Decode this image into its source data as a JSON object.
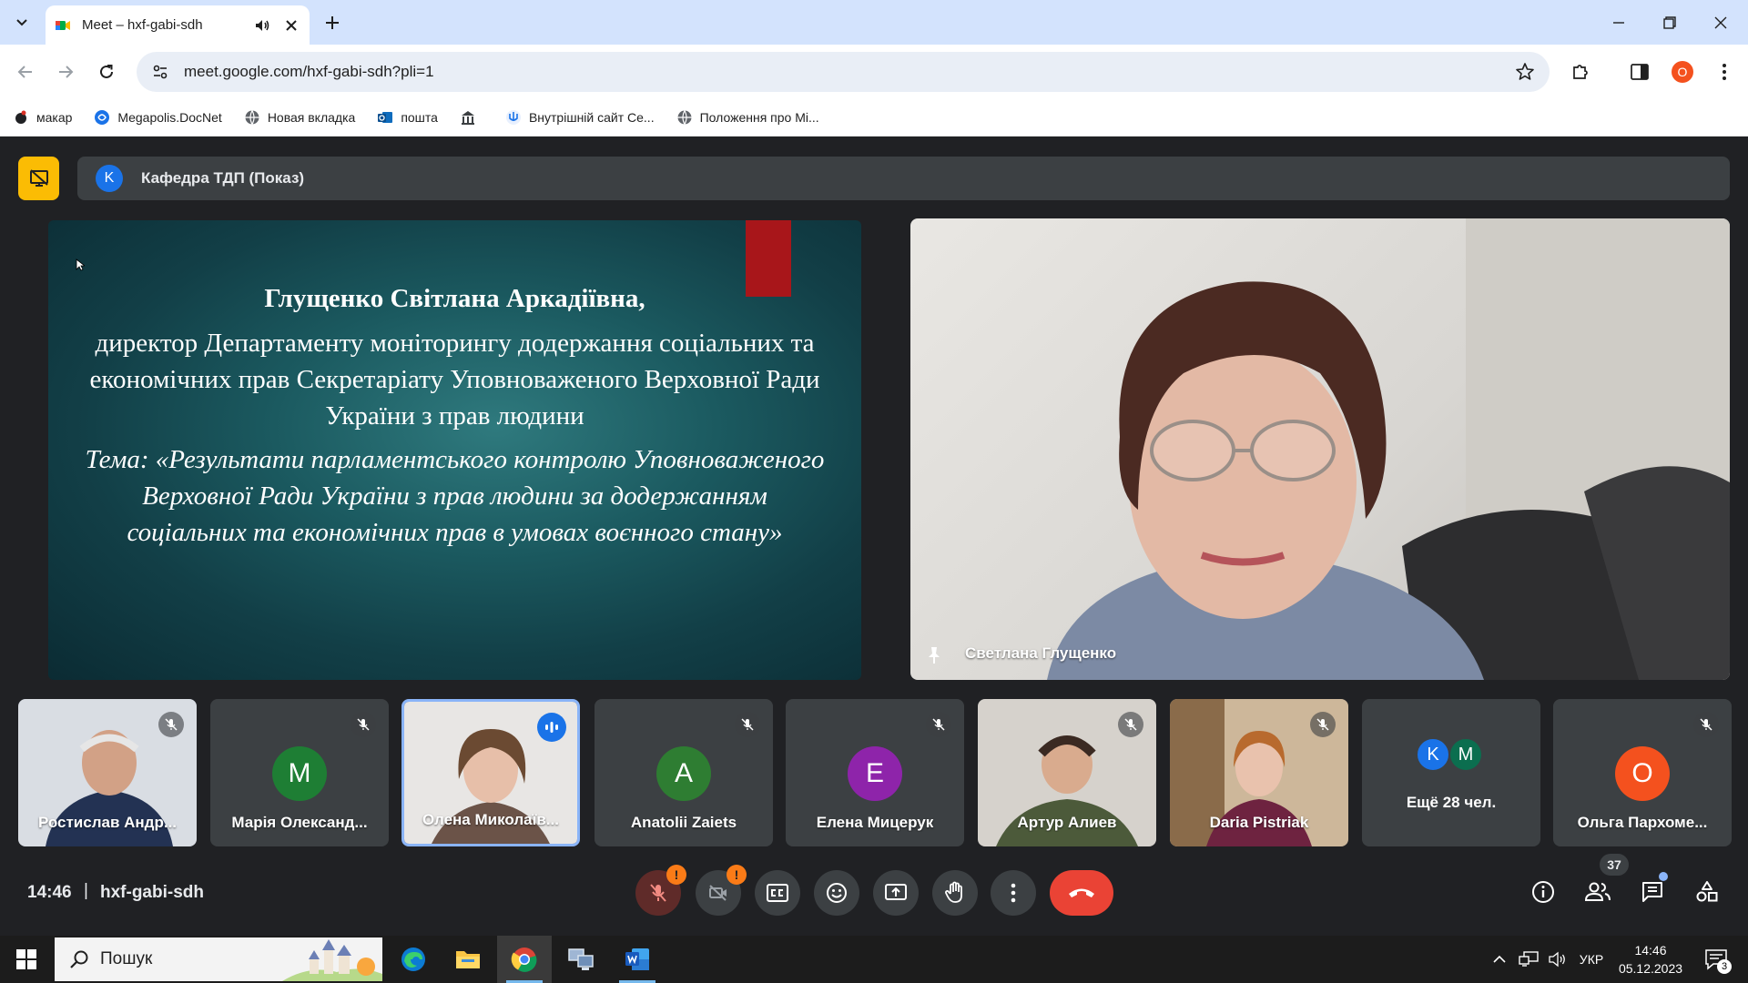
{
  "browser": {
    "tab_title": "Meet – hxf-gabi-sdh",
    "url": "meet.google.com/hxf-gabi-sdh?pli=1",
    "profile_initial": "O",
    "bookmarks": [
      {
        "label": "макар",
        "icon": "stamp-icon"
      },
      {
        "label": "Megapolis.DocNet",
        "icon": "docnet-icon"
      },
      {
        "label": "Новая вкладка",
        "icon": "globe-icon"
      },
      {
        "label": "пошта",
        "icon": "outlook-icon"
      },
      {
        "label": "",
        "icon": "building-icon"
      },
      {
        "label": "Внутрішній сайт Се...",
        "icon": "trident-icon"
      },
      {
        "label": "Положення про Мі...",
        "icon": "globe-icon"
      }
    ]
  },
  "meet": {
    "presenter_initial": "K",
    "presenter_label": "Кафедра ТДП (Показ)",
    "slide": {
      "name": "Глущенко Світлана Аркадіївна",
      "name_suffix": ",",
      "role": "директор Департаменту моніторингу додержання соціальних та економічних прав Секретаріату Уповноваженого Верховної Ради України з прав людини",
      "topic": "Тема: «Результати парламентського контролю Уповноваженого Верховної Ради України з прав людини за додержанням соціальних та економічних прав в умовах воєнного стану»"
    },
    "speaker_name": "Светлана Глущенко",
    "tiles": [
      {
        "name": "Ростислав Андр...",
        "type": "video",
        "muted": true
      },
      {
        "name": "Марія Олександ...",
        "type": "avatar",
        "initial": "М",
        "color": "#1e7e34",
        "muted": true
      },
      {
        "name": "Олена Миколаїв...",
        "type": "video",
        "muted": false,
        "speaking": true
      },
      {
        "name": "Anatolii Zaiets",
        "type": "avatar",
        "initial": "A",
        "color": "#2e7d32",
        "muted": true
      },
      {
        "name": "Елена Мицерук",
        "type": "avatar",
        "initial": "Е",
        "color": "#8e24aa",
        "muted": true
      },
      {
        "name": "Артур Алиев",
        "type": "video",
        "muted": true
      },
      {
        "name": "Daria Pistriak",
        "type": "video",
        "muted": true
      },
      {
        "name": "Ещё 28 чел.",
        "type": "more",
        "initials": [
          "K",
          "M"
        ],
        "colors": [
          "#1a73e8",
          "#0b6e4f"
        ]
      },
      {
        "name": "Ольга Пархоме...",
        "type": "avatar",
        "initial": "О",
        "color": "#f4511e",
        "muted": true
      }
    ],
    "time": "14:46",
    "separator": "|",
    "meeting_code": "hxf-gabi-sdh",
    "participants_count": "37",
    "warning_mark": "!"
  },
  "taskbar": {
    "search_label": "Пошук",
    "language": "УКР",
    "clock_time": "14:46",
    "clock_date": "05.12.2023",
    "notifications": "3"
  },
  "colors": {
    "meet_bg": "#202124",
    "tile_bg": "#3c4043",
    "hangup": "#ea4335",
    "present_accent": "#fbbc04",
    "active_border": "#8ab4f8"
  }
}
